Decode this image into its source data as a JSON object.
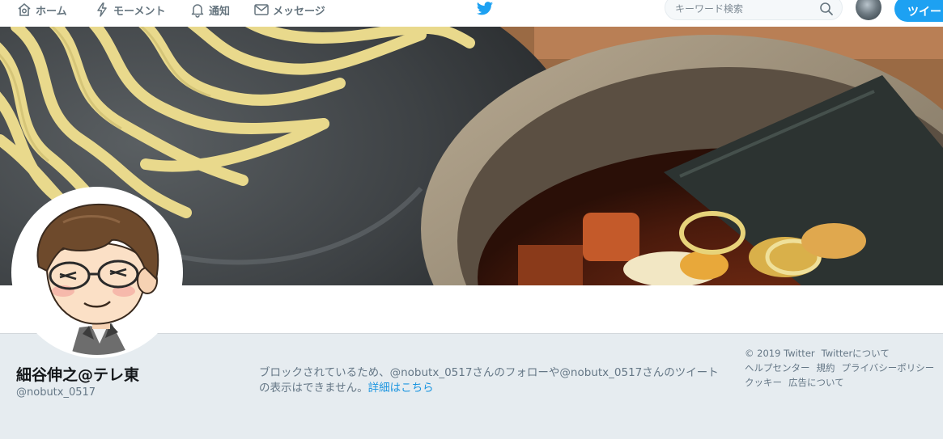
{
  "nav": {
    "home_label": "ホーム",
    "moments_label": "モーメント",
    "notifications_label": "通知",
    "messages_label": "メッセージ",
    "search_placeholder": "キーワード検索",
    "tweet_button_label": "ツイー"
  },
  "profile": {
    "name": "細谷伸之@テレ東",
    "handle": "@nobutx_0517"
  },
  "blocked": {
    "message": "ブロックされているため、@nobutx_0517さんのフォローや@nobutx_0517さんのツイートの表示はできません。",
    "details_link": "詳細はこちら"
  },
  "footer": {
    "copyright": "© 2019 Twitter",
    "about": "Twitterについて",
    "help": "ヘルプセンター",
    "terms": "規約",
    "privacy": "プライバシーポリシー",
    "cookies": "クッキー",
    "ads": "広告について"
  },
  "colors": {
    "accent": "#1da1f2",
    "link": "#1b95e0",
    "muted_text": "#657786",
    "page_bg": "#e6ecf0"
  },
  "icons": [
    "home-icon",
    "lightning-icon",
    "bell-icon",
    "envelope-icon",
    "twitter-bird-icon",
    "search-icon"
  ]
}
